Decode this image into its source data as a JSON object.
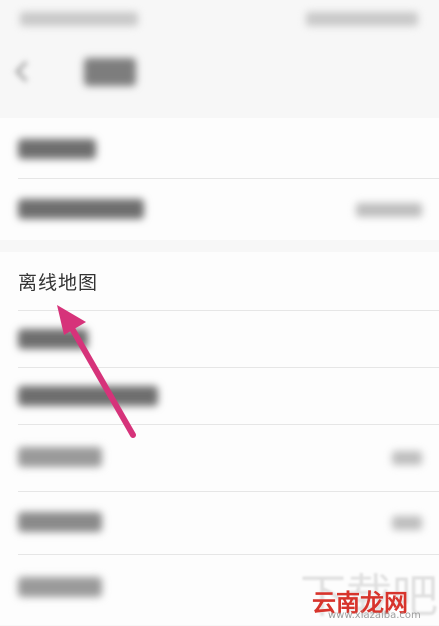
{
  "settings": {
    "offline_map_label": "离线地图"
  },
  "watermark": {
    "brand": "云南龙网",
    "url": "www.xiazaiba.com",
    "ghost_text": "下载吧"
  },
  "colors": {
    "arrow": "#d6337a",
    "background": "#f7f7f7",
    "section": "#fdfdfd"
  },
  "icons": {
    "back": "back-arrow-icon",
    "chevron": "chevron-right-icon"
  }
}
